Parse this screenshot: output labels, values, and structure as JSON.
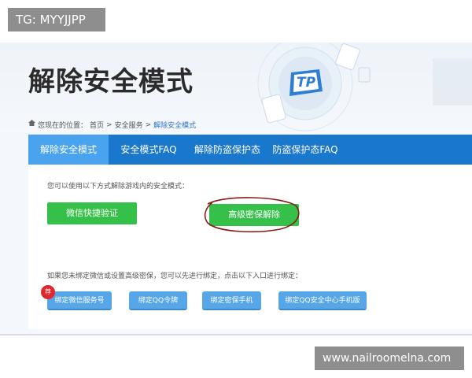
{
  "watermarks": {
    "top": "TG: MYYJJPP",
    "bottom": "www.nailroomelna.com"
  },
  "page": {
    "title": "解除安全模式",
    "logo_text": "TP",
    "breadcrumb": {
      "prefix": "您现在的位置：",
      "items": [
        "首页",
        "安全服务",
        "解除安全模式"
      ],
      "separator": ">"
    },
    "tabs": [
      {
        "label": "解除安全模式",
        "active": true
      },
      {
        "label": "安全模式FAQ",
        "active": false
      },
      {
        "label": "解除防盗保护态",
        "active": false
      },
      {
        "label": "防盗保护态FAQ",
        "active": false
      }
    ],
    "section1": {
      "hint": "您可以使用以下方式解除游戏内的安全模式：",
      "buttons": [
        "微信快捷验证",
        "高级密保解除"
      ]
    },
    "section2": {
      "hint": "如果您未绑定微信或设置高级密保，您可以先进行绑定，点击以下入口进行绑定：",
      "badge": "荐",
      "buttons": [
        "绑定微信服务号",
        "绑定QQ令牌",
        "绑定密保手机",
        "绑定QQ安全中心手机版"
      ]
    }
  },
  "colors": {
    "tab_bar": "#1a78cc",
    "tab_active": "#4aa3ef",
    "green_button": "#35c04a",
    "blue_button": "#56a6e8",
    "badge": "#e0262a",
    "annotation_circle": "#8b1a1a"
  }
}
